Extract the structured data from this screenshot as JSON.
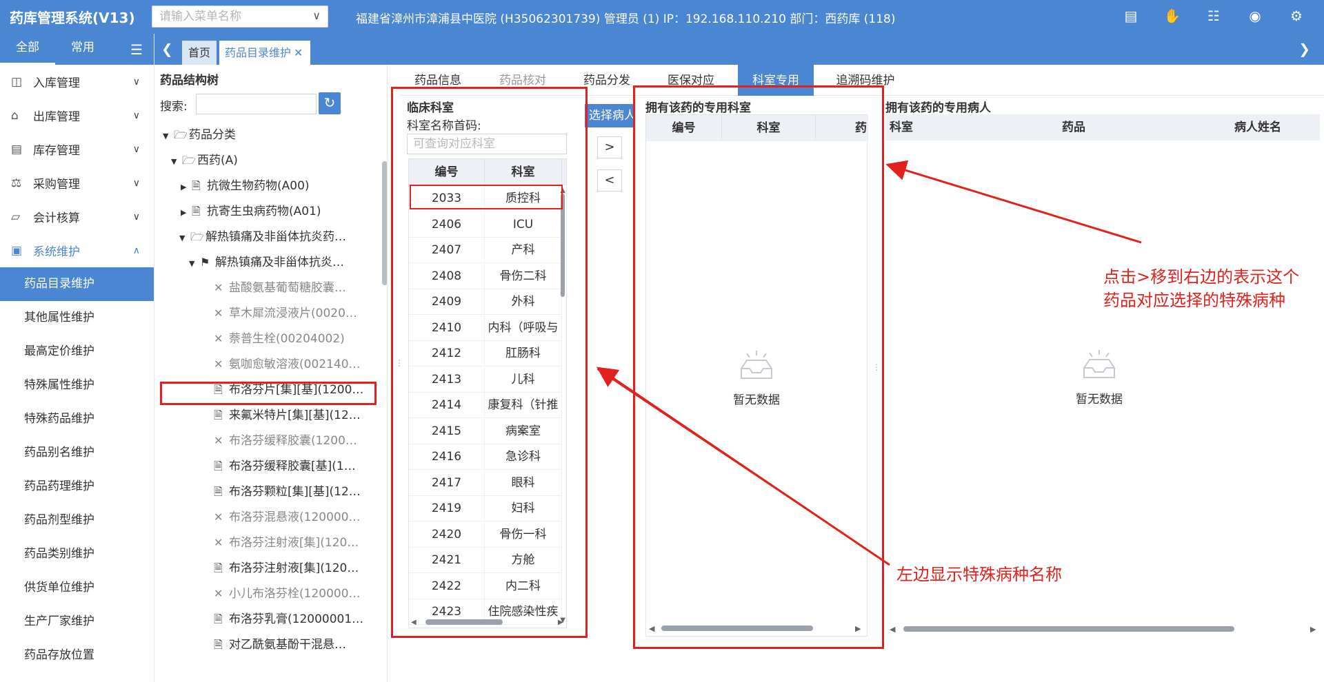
{
  "header": {
    "app_title": "药库管理系统(V13)",
    "menu_search_placeholder": "请输入菜单名称",
    "info": "福建省漳州市漳浦县中医院 (H35062301739) 管理员 (1) IP：192.168.110.210 部门：西药库 (118)",
    "icons": [
      "cashier-icon",
      "hand-icon",
      "document-icon",
      "eye-icon",
      "gear-icon"
    ]
  },
  "sidebar": {
    "tabs": [
      "全部",
      "常用"
    ],
    "groups": [
      {
        "label": "入库管理",
        "icon": "inbound-icon"
      },
      {
        "label": "出库管理",
        "icon": "outbound-icon"
      },
      {
        "label": "库存管理",
        "icon": "inventory-icon"
      },
      {
        "label": "采购管理",
        "icon": "purchase-icon"
      },
      {
        "label": "会计核算",
        "icon": "accounting-icon"
      },
      {
        "label": "系统维护",
        "icon": "system-icon"
      }
    ],
    "sub_items": [
      "药品目录维护",
      "其他属性维护",
      "最高定价维护",
      "特殊属性维护",
      "特殊药品维护",
      "药品别名维护",
      "药品药理维护",
      "药品剂型维护",
      "药品类别维护",
      "供货单位维护",
      "生产厂家维护",
      "药品存放位置"
    ]
  },
  "tabs": {
    "home": "首页",
    "current": "药品目录维护"
  },
  "tree": {
    "title": "药品结构树",
    "search_label": "搜索:",
    "nodes": [
      {
        "label": "药品分类"
      },
      {
        "label": "西药(A)"
      },
      {
        "label": "抗微生物药物(A00)"
      },
      {
        "label": "抗寄生虫病药物(A01)"
      },
      {
        "label": "解热镇痛及非甾体抗炎药…"
      },
      {
        "label": "解热镇痛及非甾体抗炎…"
      },
      {
        "label": "盐酸氨基葡萄糖胶囊…"
      },
      {
        "label": "草木犀流浸液片(0020…"
      },
      {
        "label": "萘普生栓(00204002)"
      },
      {
        "label": "氨咖愈敏溶液(002140…"
      },
      {
        "label": "布洛芬片[集][基](1200…"
      },
      {
        "label": "来氟米特片[集][基](12…"
      },
      {
        "label": "布洛芬缓释胶囊(1200…"
      },
      {
        "label": "布洛芬缓释胶囊[基](1…"
      },
      {
        "label": "布洛芬颗粒[集][基](12…"
      },
      {
        "label": "布洛芬混悬液(120000…"
      },
      {
        "label": "布洛芬注射液[集](120…"
      },
      {
        "label": "布洛芬注射液[集](120…"
      },
      {
        "label": "小儿布洛芬栓(120000…"
      },
      {
        "label": "布洛芬乳膏(12000001…"
      },
      {
        "label": "对乙酰氨基酚干混悬…"
      }
    ]
  },
  "detail_tabs": [
    "药品信息",
    "药品核对",
    "药品分发",
    "医保对应",
    "科室专用",
    "追溯码维护"
  ],
  "clinic": {
    "title": "临床科室",
    "search_label": "科室名称首码:",
    "search_placeholder": "可查询对应科室",
    "columns": [
      "编号",
      "科室"
    ],
    "rows": [
      [
        "2033",
        "质控科"
      ],
      [
        "2406",
        "ICU"
      ],
      [
        "2407",
        "产科"
      ],
      [
        "2408",
        "骨伤二科"
      ],
      [
        "2409",
        "外科"
      ],
      [
        "2410",
        "内科（呼吸与"
      ],
      [
        "2412",
        "肛肠科"
      ],
      [
        "2413",
        "儿科"
      ],
      [
        "2414",
        "康复科（针推"
      ],
      [
        "2415",
        "病案室"
      ],
      [
        "2416",
        "急诊科"
      ],
      [
        "2417",
        "眼科"
      ],
      [
        "2419",
        "妇科"
      ],
      [
        "2420",
        "骨伤一科"
      ],
      [
        "2421",
        "方舱"
      ],
      [
        "2422",
        "内二科"
      ],
      [
        "2423",
        "住院感染性疾"
      ]
    ]
  },
  "select_patient_label": "选择病人",
  "move_right": ">",
  "move_left": "<",
  "dept": {
    "title": "拥有该药的专用科室",
    "columns": [
      "编号",
      "科室",
      "药"
    ],
    "empty": "暂无数据"
  },
  "patient": {
    "title": "拥有该药的专用病人",
    "columns": [
      "科室",
      "药品",
      "病人姓名"
    ],
    "empty": "暂无数据"
  },
  "annotations": {
    "right_note_line1": "点击>移到右边的表示这个",
    "right_note_line2": "药品对应选择的特殊病种",
    "left_note": "左边显示特殊病种名称",
    "color": "#e3201b"
  },
  "colors": {
    "primary": "#4a86d1"
  }
}
